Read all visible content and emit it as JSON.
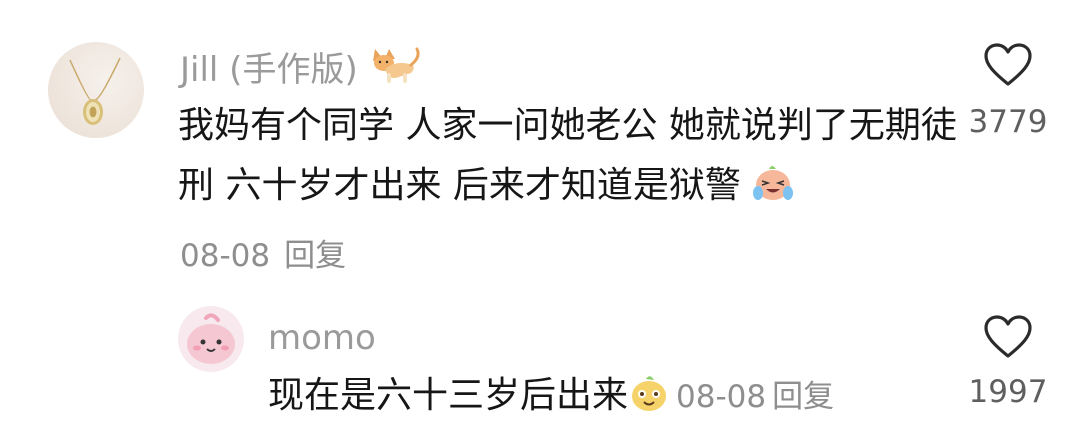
{
  "comments": [
    {
      "username": "Jill (手作版)",
      "username_emoji": "cat-emoji",
      "text": "我妈有个同学 人家一问她老公 她就说判了无期徒刑 六十岁才出来 后来才知道是狱警",
      "text_emoji": "laughing-crying-emoji",
      "date": "08-08",
      "reply_label": "回复",
      "like_count": "3779",
      "like_icon": "heart-outline-icon"
    },
    {
      "username": "momo",
      "text": "现在是六十三岁后出来",
      "text_emoji": "sly-smile-emoji",
      "date": "08-08",
      "reply_label": "回复",
      "like_count": "1997",
      "like_icon": "heart-outline-icon"
    }
  ],
  "colors": {
    "username": "#9a9a9a",
    "text": "#161616",
    "meta": "#8e8e8e",
    "count": "#5f5f5f",
    "icon_stroke": "#2b2b2b"
  }
}
